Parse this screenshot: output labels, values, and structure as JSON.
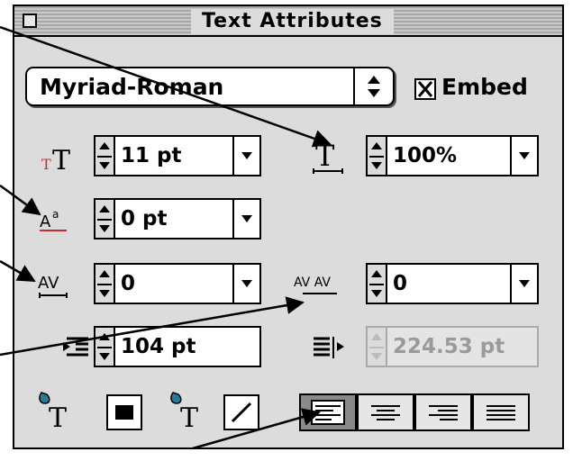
{
  "window": {
    "title": "Text Attributes"
  },
  "font": {
    "name": "Myriad-Roman",
    "embed_label": "Embed",
    "embed_checked": true
  },
  "fields": {
    "size": "11 pt",
    "horizontal_scale": "100%",
    "baseline_shift": "0 pt",
    "kerning": "0",
    "tracking": "0",
    "indent": "104 pt",
    "right_indent": "224.53 pt"
  },
  "icons": {
    "size": "font-size-icon",
    "horizontal_scale": "horizontal-scale-icon",
    "baseline_shift": "baseline-shift-icon",
    "kerning": "kerning-icon",
    "tracking": "tracking-icon",
    "indent": "indent-icon",
    "right_indent": "right-indent-icon",
    "fill": "text-fill-icon",
    "stroke": "text-stroke-icon"
  },
  "alignment": {
    "options": [
      "left",
      "center",
      "right",
      "justify"
    ],
    "selected": "left"
  },
  "colors": {
    "panel": "#dcdcdc",
    "active_align": "#8a8a8a",
    "fill_swatch": "#000000"
  }
}
